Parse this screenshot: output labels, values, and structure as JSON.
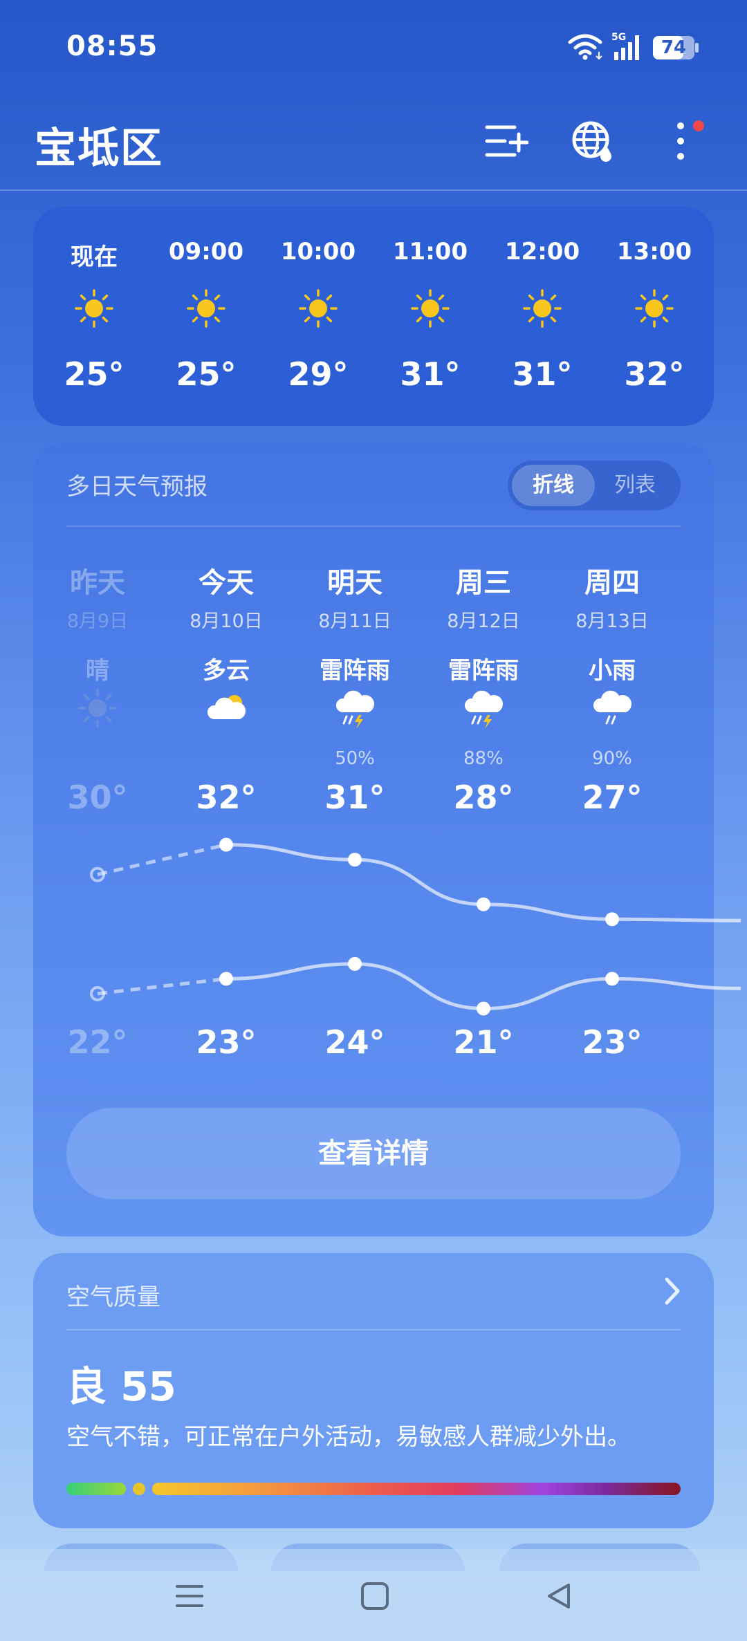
{
  "status_bar": {
    "time": "08:55",
    "network": "5G",
    "battery": "74",
    "battery_level": 0.74
  },
  "header": {
    "city": "宝坻区",
    "icons": [
      "add-list-icon",
      "globe-rain-icon",
      "more-menu-icon"
    ],
    "notification_dot_color": "#f04848"
  },
  "hourly": [
    {
      "time": "现在",
      "icon": "sun-icon",
      "temp": "25°"
    },
    {
      "time": "09:00",
      "icon": "sun-icon",
      "temp": "25°"
    },
    {
      "time": "10:00",
      "icon": "sun-icon",
      "temp": "29°"
    },
    {
      "time": "11:00",
      "icon": "sun-icon",
      "temp": "31°"
    },
    {
      "time": "12:00",
      "icon": "sun-icon",
      "temp": "31°"
    },
    {
      "time": "13:00",
      "icon": "sun-icon",
      "temp": "32°"
    }
  ],
  "forecast": {
    "title": "多日天气预报",
    "toggle": {
      "active": "折线",
      "inactive": "列表"
    },
    "days": [
      {
        "name": "昨天",
        "date": "8月9日",
        "cond": "晴",
        "icon": "sun-icon",
        "precip": "",
        "high": "30°",
        "low": "22°"
      },
      {
        "name": "今天",
        "date": "8月10日",
        "cond": "多云",
        "icon": "partly-cloudy-icon",
        "precip": "",
        "high": "32°",
        "low": "23°"
      },
      {
        "name": "明天",
        "date": "8月11日",
        "cond": "雷阵雨",
        "icon": "thunderstorm-icon",
        "precip": "50%",
        "high": "31°",
        "low": "24°"
      },
      {
        "name": "周三",
        "date": "8月12日",
        "cond": "雷阵雨",
        "icon": "thunderstorm-icon",
        "precip": "88%",
        "high": "28°",
        "low": "21°"
      },
      {
        "name": "周四",
        "date": "8月13日",
        "cond": "小雨",
        "icon": "light-rain-icon",
        "precip": "90%",
        "high": "27°",
        "low": "23°"
      }
    ],
    "details_button": "查看详情"
  },
  "chart_data": {
    "type": "line",
    "categories": [
      "昨天",
      "今天",
      "明天",
      "周三",
      "周四"
    ],
    "series": [
      {
        "values": [
          30,
          32,
          31,
          28,
          27
        ]
      },
      {
        "values": [
          22,
          23,
          24,
          21,
          23
        ]
      }
    ]
  },
  "air_quality": {
    "title": "空气质量",
    "value": "良 55",
    "description": "空气不错，可正常在户外活动，易敏感人群减少外出。"
  },
  "colors": {
    "sun": "#f8c61c",
    "accent": "#2c5fd6"
  },
  "nav": [
    "menu-icon",
    "home-icon",
    "back-icon"
  ]
}
